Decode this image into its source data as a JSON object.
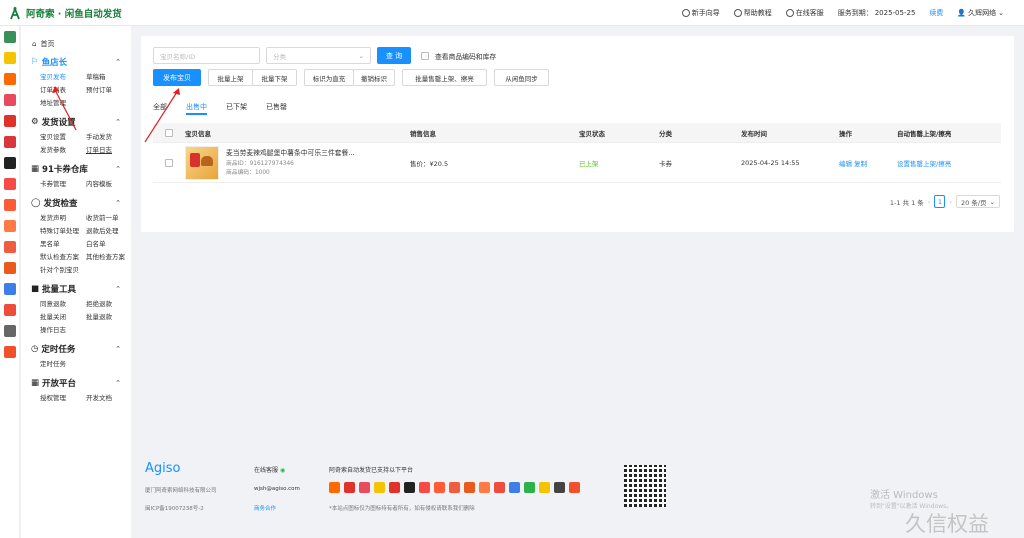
{
  "header": {
    "app_title": "阿奇索 · 闲鱼自动发货",
    "guide": "新手向导",
    "help": "帮助教程",
    "support": "在线客服",
    "service_expiry_label": "服务到期：",
    "service_expiry_date": "2025-05-25",
    "renew": "续费",
    "user": "久辉网络"
  },
  "sidebar": {
    "home": "首页",
    "sections": [
      {
        "title": "鱼店长",
        "items": [
          "宝贝发布",
          "草稿箱",
          "订单列表",
          "预付订单",
          "地址管理"
        ]
      },
      {
        "title": "发货设置",
        "items": [
          "宝贝设置",
          "手动发货",
          "发货参数",
          "订单日志"
        ]
      },
      {
        "title": "91卡券仓库",
        "items": [
          "卡券管理",
          "内容模板"
        ]
      },
      {
        "title": "发货检查",
        "items": [
          "发货声明",
          "收货前一单",
          "特殊订单处理",
          "退款后处理",
          "黑名单",
          "白名单",
          "默认检查方案",
          "其他检查方案",
          "针对个别宝贝"
        ]
      },
      {
        "title": "批量工具",
        "items": [
          "同意退款",
          "拒绝退款",
          "批量关闭",
          "批量退款",
          "操作日志"
        ]
      },
      {
        "title": "定时任务",
        "items": [
          "定时任务"
        ]
      },
      {
        "title": "开放平台",
        "items": [
          "授权管理",
          "开发文档"
        ]
      }
    ]
  },
  "filters": {
    "name_placeholder": "宝贝名称/ID",
    "category_placeholder": "分类",
    "query": "查 询",
    "show_code_stock": "查看商品编码和库存"
  },
  "actions": {
    "publish": "发布宝贝",
    "bulk_list": "批量上架",
    "bulk_delist": "批量下架",
    "mark_shine": "标识为直充",
    "unmark": "撤销标识",
    "bulk_sold": "批量售罄上架、擦亮",
    "sync": "从闲鱼同步"
  },
  "tabs": [
    "全部",
    "出售中",
    "已下架",
    "已售罄"
  ],
  "table": {
    "headers": [
      "宝贝信息",
      "销售信息",
      "宝贝状态",
      "分类",
      "发布时间",
      "操作",
      "自动售罄上架/擦亮"
    ],
    "rows": [
      {
        "title": "麦当劳麦辣鸡腿堡中薯条中可乐三件套餐...",
        "item_id": "商品ID：916127974346",
        "item_code": "商品编码：1000",
        "price": "售价：¥20.5",
        "status": "已上架",
        "category": "卡券",
        "time": "2025-04-25 14:55",
        "edit": "编辑",
        "copy": "复制",
        "auto": "设置售罄上架/擦亮"
      }
    ]
  },
  "pagination": {
    "summary": "1-1 共 1 条",
    "page": "1",
    "page_size": "20 条/页"
  },
  "footer": {
    "brand": "Agiso",
    "company": "厦门阿奇索网络科技有限公司",
    "icp": "闽ICP备19007238号-2",
    "online_service": "在线客服",
    "email": "wjsh@agiso.com",
    "business": "商务合作",
    "platforms_title": "阿奇索自动发货已支持以下平台",
    "platforms_note": "*本站点图标仅为图标持有者所有，如有侵权请联系我们删除"
  },
  "watermark": {
    "win1": "激活 Windows",
    "win2": "转到\"设置\"以激活 Windows。",
    "site": "久信权益"
  },
  "colors": {
    "primary": "#1890ff",
    "brand_green": "#1a7f3c",
    "status_green": "#52c41a"
  }
}
